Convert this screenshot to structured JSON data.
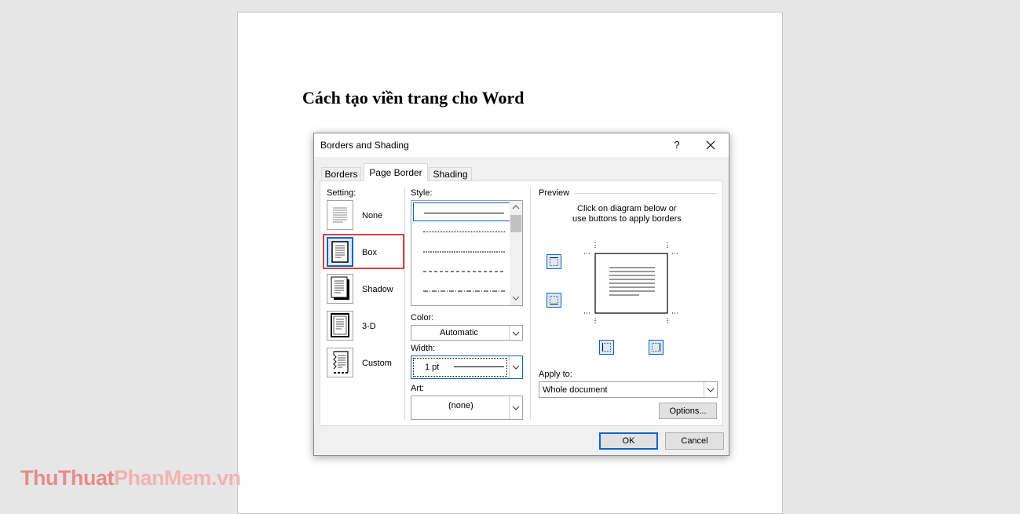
{
  "document": {
    "heading": "Cách tạo viền trang cho Word"
  },
  "watermark": {
    "part1": "ThuThuat",
    "part2": "PhanMem",
    "part3": ".vn"
  },
  "dialog": {
    "title": "Borders and Shading",
    "help_label": "?",
    "tabs": [
      {
        "label": "Borders",
        "active": false
      },
      {
        "label": "Page Border",
        "active": true
      },
      {
        "label": "Shading",
        "active": false
      }
    ],
    "setting": {
      "label": "Setting:",
      "options": [
        {
          "label": "None",
          "selected": false
        },
        {
          "label": "Box",
          "selected": true
        },
        {
          "label": "Shadow",
          "selected": false
        },
        {
          "label": "3-D",
          "selected": false
        },
        {
          "label": "Custom",
          "selected": false
        }
      ]
    },
    "style": {
      "label": "Style:",
      "items": [
        "solid",
        "dotted",
        "dense-dash",
        "dash",
        "dash-dot"
      ]
    },
    "color": {
      "label": "Color:",
      "value": "Automatic"
    },
    "width": {
      "label": "Width:",
      "value": "1 pt"
    },
    "art": {
      "label": "Art:",
      "value": "(none)"
    },
    "preview": {
      "label": "Preview",
      "instruction_line1": "Click on diagram below or",
      "instruction_line2": "use buttons to apply borders"
    },
    "apply_to": {
      "label": "Apply to:",
      "value": "Whole document"
    },
    "buttons": {
      "options": "Options...",
      "ok": "OK",
      "cancel": "Cancel"
    }
  },
  "colors": {
    "accent": "#0a63c9",
    "highlight": "#e23c3c"
  }
}
